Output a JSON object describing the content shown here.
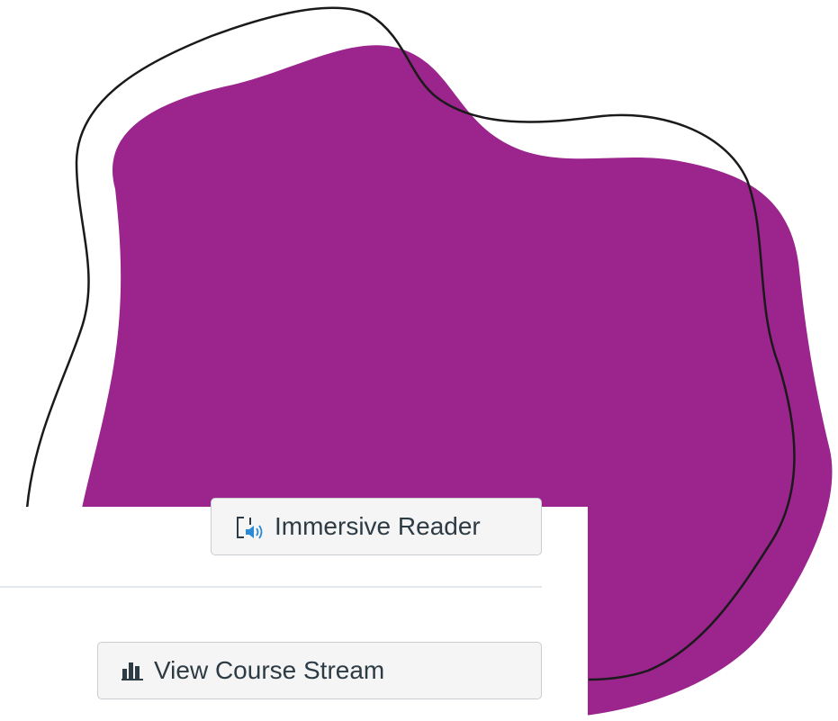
{
  "buttons": {
    "immersive_reader": "Immersive Reader",
    "view_course_stream": "View Course Stream"
  },
  "icons": {
    "immersive_reader": "immersive-reader-icon",
    "course_stream": "bar-chart-icon"
  },
  "colors": {
    "blob": "#9b248d",
    "outline": "#1a1a1a",
    "button_bg": "#f5f5f5",
    "button_border": "#c7cdd1",
    "button_text": "#2d3b45",
    "speaker_blue": "#2b8ad6"
  }
}
